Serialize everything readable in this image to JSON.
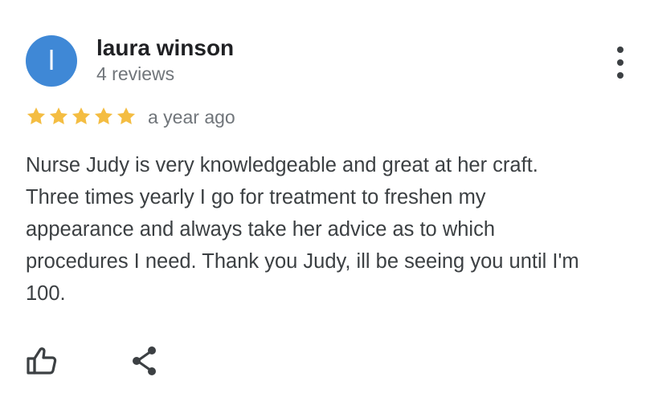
{
  "reviewer": {
    "initial": "l",
    "name": "laura winson",
    "review_count": "4 reviews",
    "avatar_color": "#3f88d6"
  },
  "rating": {
    "stars": 5,
    "max": 5,
    "star_color": "#f4bd42",
    "time_ago": "a year ago"
  },
  "review": {
    "lines": [
      "Nurse Judy is very knowledgeable and great at her craft.",
      "Three times yearly I go for treatment to freshen my",
      "appearance and always take her advice as to which",
      "procedures I need. Thank you Judy, ill be seeing you until I'm",
      "100."
    ]
  },
  "actions": {
    "more_icon": "more-vert-icon",
    "like_icon": "thumbs-up-icon",
    "share_icon": "share-icon"
  }
}
